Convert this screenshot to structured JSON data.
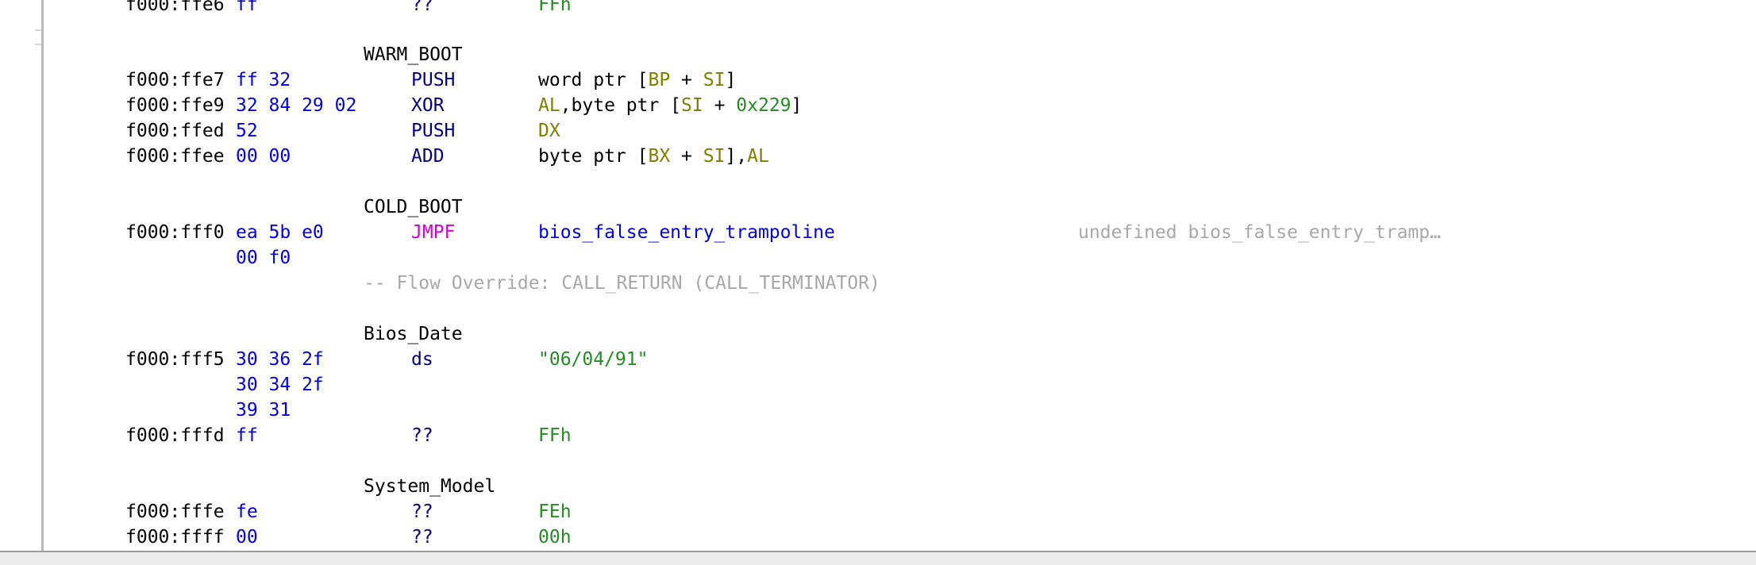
{
  "rows": {
    "r0": {
      "addr": "f000:ffe6",
      "bytes": "ff",
      "mnem": "??",
      "operand": "FFh"
    },
    "warm_boot_label": "WARM_BOOT",
    "r1": {
      "addr": "f000:ffe7",
      "bytes": "ff 32",
      "mnem": "PUSH",
      "op_a": "word ptr [",
      "op_b": "BP",
      "op_c": " + ",
      "op_d": "SI",
      "op_e": "]"
    },
    "r2": {
      "addr": "f000:ffe9",
      "bytes": "32 84 29 02",
      "mnem": "XOR",
      "op_a": "AL",
      "op_b": ",byte ptr [",
      "op_c": "SI",
      "op_d": " + ",
      "op_e": "0x229",
      "op_f": "]"
    },
    "r3": {
      "addr": "f000:ffed",
      "bytes": "52",
      "mnem": "PUSH",
      "op_a": "DX"
    },
    "r4": {
      "addr": "f000:ffee",
      "bytes": "00 00",
      "mnem": "ADD",
      "op_a": "byte ptr [",
      "op_b": "BX",
      "op_c": " + ",
      "op_d": "SI",
      "op_e": "],",
      "op_f": "AL"
    },
    "cold_boot_label": "COLD_BOOT",
    "r5": {
      "addr": "f000:fff0",
      "bytes": "ea 5b e0",
      "bytes2": "00 f0",
      "mnem": "JMPF",
      "operand": "bios_false_entry_trampoline",
      "eol_comment": "undefined bios_false_entry_tramp…"
    },
    "flow_override": "-- Flow Override: CALL_RETURN (CALL_TERMINATOR)",
    "bios_date_label": "Bios_Date",
    "r6": {
      "addr": "f000:fff5",
      "bytes": "30 36 2f",
      "bytes2": "30 34 2f",
      "bytes3": "39 31",
      "mnem": "ds",
      "operand": "\"06/04/91\""
    },
    "r7": {
      "addr": "f000:fffd",
      "bytes": "ff",
      "mnem": "??",
      "operand": "FFh"
    },
    "system_model_label": "System_Model",
    "r8": {
      "addr": "f000:fffe",
      "bytes": "fe",
      "mnem": "??",
      "operand": "FEh"
    },
    "r9": {
      "addr": "f000:ffff",
      "bytes": "00",
      "mnem": "??",
      "operand": "00h"
    }
  },
  "colors": {
    "address": "#000000",
    "bytes": "#0000dd",
    "mnemonic": "#000080",
    "jump_mnemonic": "#d400d4",
    "register": "#7f7f00",
    "scalar": "#238c23",
    "comment": "#a8a8a8"
  }
}
